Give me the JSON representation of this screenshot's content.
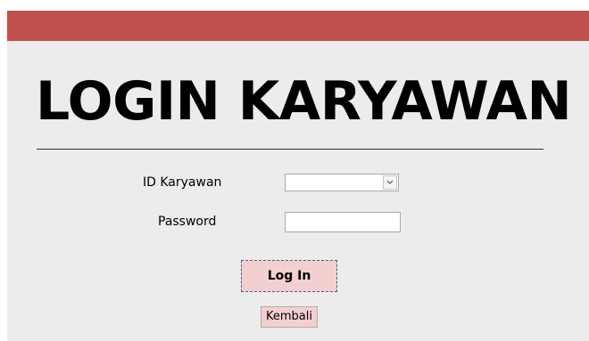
{
  "form": {
    "heading": "LOGIN KARYAWAN",
    "id_label": "ID Karyawan",
    "id_value": "",
    "password_label": "Password",
    "password_value": ""
  },
  "buttons": {
    "login_label": "Log In",
    "back_label": "Kembali"
  },
  "icons": {
    "dropdown": "chevron-down-icon"
  },
  "colors": {
    "title_bar": "#c0504d",
    "window_background": "#ececec",
    "button_fill": "#f2d0cf"
  }
}
